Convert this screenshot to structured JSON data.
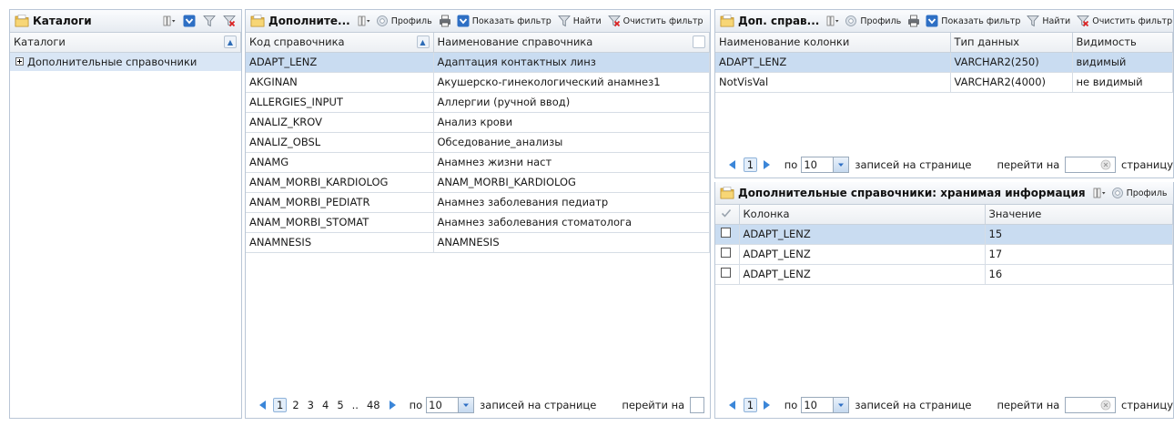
{
  "catalogs": {
    "title": "Каталоги",
    "column_header": "Каталоги",
    "tree_items": [
      {
        "label": "Дополнительные справочники"
      }
    ]
  },
  "directories": {
    "title": "Дополните...",
    "buttons": {
      "profile": "Профиль",
      "show_filter": "Показать фильтр",
      "find": "Найти",
      "clear_filter": "Очистить фильтр"
    },
    "columns": [
      "Код справочника",
      "Наименование справочника"
    ],
    "rows": [
      {
        "code": "ADAPT_LENZ",
        "name": "Адаптация контактных линз"
      },
      {
        "code": "AKGINAN",
        "name": "Акушерско-гинекологический анамнез1"
      },
      {
        "code": "ALLERGIES_INPUT",
        "name": "Аллергии (ручной ввод)"
      },
      {
        "code": "ANALIZ_KROV",
        "name": "Анализ крови"
      },
      {
        "code": "ANALIZ_OBSL",
        "name": "Обседование_анализы"
      },
      {
        "code": "ANAMG",
        "name": "Анамнез жизни наст"
      },
      {
        "code": "ANAM_MORBI_KARDIOLOG",
        "name": "ANAM_MORBI_KARDIOLOG"
      },
      {
        "code": "ANAM_MORBI_PEDIATR",
        "name": "Анамнез заболевания педиатр"
      },
      {
        "code": "ANAM_MORBI_STOMAT",
        "name": "Анамнез заболевания стоматолога"
      },
      {
        "code": "ANAMNESIS",
        "name": "ANAMNESIS"
      }
    ],
    "pager": {
      "pages": [
        "1",
        "2",
        "3",
        "4",
        "5",
        "..",
        "48"
      ],
      "per_page_prefix": "по",
      "per_page": "10",
      "per_page_suffix": "записей на странице",
      "goto_label": "перейти на"
    }
  },
  "columns_panel": {
    "title": "Доп. справ...",
    "buttons": {
      "profile": "Профиль",
      "show_filter": "Показать фильтр",
      "find": "Найти",
      "clear_filter": "Очистить фильтр"
    },
    "columns": [
      "Наименование колонки",
      "Тип данных",
      "Видимость"
    ],
    "rows": [
      {
        "name": "ADAPT_LENZ",
        "type": "VARCHAR2(250)",
        "visibility": "видимый"
      },
      {
        "name": "NotVisVal",
        "type": "VARCHAR2(4000)",
        "visibility": "не видимый"
      }
    ],
    "pager": {
      "page": "1",
      "per_page_prefix": "по",
      "per_page": "10",
      "per_page_suffix": "записей на странице",
      "goto_label": "перейти на",
      "page_suffix": "страницу"
    }
  },
  "stored_panel": {
    "title": "Дополнительные справочники: хранимая информация",
    "buttons": {
      "profile": "Профиль"
    },
    "columns": [
      "Колонка",
      "Значение"
    ],
    "rows": [
      {
        "column": "ADAPT_LENZ",
        "value": "15"
      },
      {
        "column": "ADAPT_LENZ",
        "value": "17"
      },
      {
        "column": "ADAPT_LENZ",
        "value": "16"
      }
    ],
    "pager": {
      "page": "1",
      "per_page_prefix": "по",
      "per_page": "10",
      "per_page_suffix": "записей на странице",
      "goto_label": "перейти на",
      "page_suffix": "страницу"
    }
  },
  "icons": {
    "folder": "folder-icon",
    "columns": "columns-menu-icon",
    "profile": "gear-icon",
    "print": "printer-icon",
    "show_filter": "show-filter-icon",
    "find": "funnel-icon",
    "clear_filter": "clear-filter-icon",
    "sort": "sort-icon",
    "expand": "plus-box-icon",
    "prev": "arrow-left-icon",
    "next": "arrow-right-icon",
    "dropdown": "chevron-down-icon",
    "clear_input": "clear-input-icon",
    "select_all": "checkmark-icon"
  },
  "colors": {
    "selected_row": "#c9dcf1",
    "border": "#b9c6d6",
    "toolbar_blue": "#2e6fc4"
  }
}
